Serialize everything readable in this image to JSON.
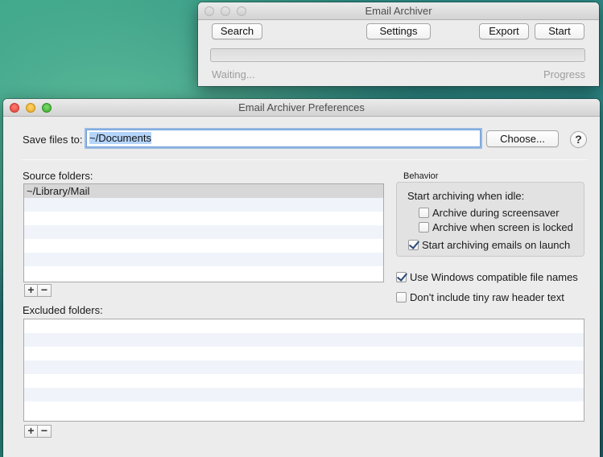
{
  "main_window": {
    "title": "Email Archiver",
    "search_label": "Search",
    "settings_label": "Settings",
    "export_label": "Export",
    "start_label": "Start",
    "progress": 0,
    "status_text": "Waiting...",
    "progress_label": "Progress"
  },
  "prefs": {
    "title": "Email Archiver Preferences",
    "save_label": "Save files to:",
    "save_path": "~/Documents",
    "choose_label": "Choose...",
    "help_label": "?",
    "source_label": "Source folders:",
    "source_folders": [
      "~/Library/Mail"
    ],
    "excluded_label": "Excluded folders:",
    "excluded_folders": [],
    "add_label": "+",
    "remove_label": "−",
    "behavior": {
      "title": "Behavior",
      "idle_label": "Start archiving when idle:",
      "options": [
        {
          "label": "Archive during screensaver",
          "checked": false
        },
        {
          "label": "Archive when screen is locked",
          "checked": false
        },
        {
          "label": "Start archiving emails on launch",
          "checked": true
        }
      ]
    },
    "windows_names": {
      "label": "Use Windows compatible file names",
      "checked": true
    },
    "tiny_header": {
      "label": "Don't include tiny raw header text",
      "checked": false
    }
  }
}
